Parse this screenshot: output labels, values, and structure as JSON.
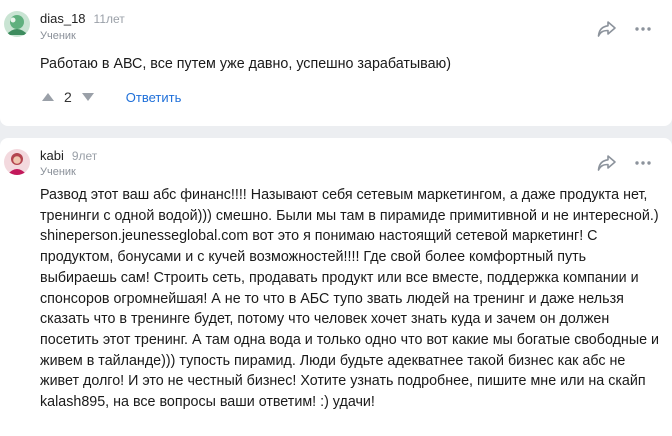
{
  "comments": [
    {
      "username": "dias_18",
      "time": "11лет",
      "role": "Ученик",
      "text": "Работаю в АВС, все путем уже давно, успешно зарабатываю)",
      "votes": "2",
      "reply_label": "Ответить"
    },
    {
      "username": "kabi",
      "time": "9лет",
      "role": "Ученик",
      "text": "Развод этот ваш абс финанс!!!! Называют себя сетевым маркетингом, а даже продукта нет, тренинги с одной водой))) смешно. Были мы там в пирамиде примитивной и не интересной.) shineperson.jeunesseglobal.com вот это я понимаю настоящий сетевой маркетинг! С продуктом, бонусами и с кучей возможностей!!!! Где свой более комфортный путь выбираешь сам! Строить сеть, продавать продукт или все вместе, поддержка компании и спонсоров огромнейшая! А не то что в АБС тупо звать людей на тренинг и даже нельзя сказать что в тренинге будет, потому что человек хочет знать куда и зачем он должен посетить этот тренинг. А там одна вода и только одно что вот какие мы богатые свободные и живем в тайланде))) тупость пирамид. Люди будьте адекватнее такой бизнес как абс не живет долго! И это не честный бизнес! Хотите узнать подробнее, пишите мне или на скайп kalash895, на все вопросы ваши ответим! :) удачи!"
    }
  ],
  "icons": {
    "share": "share-arrow-icon",
    "more": "more-dots-icon",
    "upvote": "triangle-up-icon",
    "downvote": "triangle-down-icon"
  },
  "colors": {
    "background": "#eceef1",
    "link": "#1e6fd9",
    "muted": "#9aa0a8",
    "icon": "#8c939c"
  }
}
